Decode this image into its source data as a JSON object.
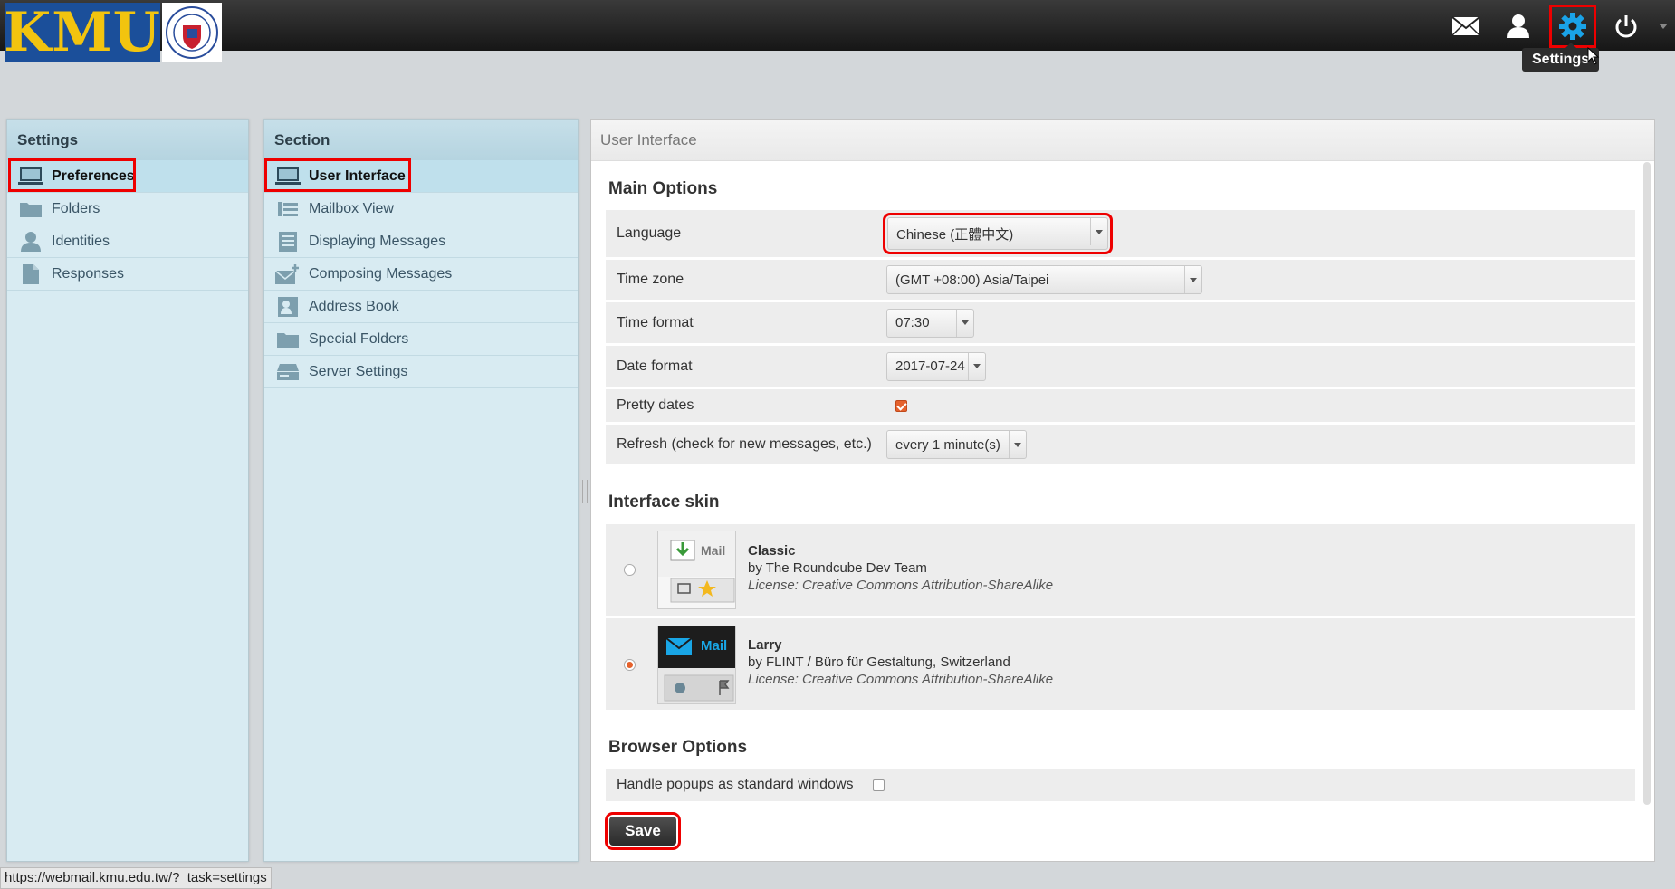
{
  "header": {
    "logo_text": "KMU",
    "tooltip": "Settings",
    "icons": [
      "mail-icon",
      "user-icon",
      "gear-icon",
      "power-icon"
    ]
  },
  "settings_panel": {
    "title": "Settings",
    "items": [
      {
        "label": "Preferences",
        "icon": "monitor-icon",
        "selected": true
      },
      {
        "label": "Folders",
        "icon": "folder-icon"
      },
      {
        "label": "Identities",
        "icon": "person-icon"
      },
      {
        "label": "Responses",
        "icon": "document-icon"
      }
    ]
  },
  "section_panel": {
    "title": "Section",
    "items": [
      {
        "label": "User Interface",
        "icon": "monitor-icon",
        "selected": true
      },
      {
        "label": "Mailbox View",
        "icon": "list-icon"
      },
      {
        "label": "Displaying Messages",
        "icon": "message-icon"
      },
      {
        "label": "Composing Messages",
        "icon": "compose-icon"
      },
      {
        "label": "Address Book",
        "icon": "addressbook-icon"
      },
      {
        "label": "Special Folders",
        "icon": "folder-icon"
      },
      {
        "label": "Server Settings",
        "icon": "server-icon"
      }
    ]
  },
  "main": {
    "title": "User Interface",
    "main_options_title": "Main Options",
    "rows": {
      "language": {
        "label": "Language",
        "value": "Chinese (正體中文)"
      },
      "timezone": {
        "label": "Time zone",
        "value": "(GMT +08:00) Asia/Taipei"
      },
      "time_format": {
        "label": "Time format",
        "value": "07:30"
      },
      "date_format": {
        "label": "Date format",
        "value": "2017-07-24"
      },
      "pretty_dates": {
        "label": "Pretty dates",
        "checked": true
      },
      "refresh": {
        "label": "Refresh (check for new messages, etc.)",
        "value": "every 1 minute(s)"
      }
    },
    "skin_title": "Interface skin",
    "skins": [
      {
        "name": "Classic",
        "author": "by The Roundcube Dev Team",
        "license": "License: Creative Commons Attribution-ShareAlike",
        "thumb_label": "Mail",
        "selected": false
      },
      {
        "name": "Larry",
        "author": "by FLINT / Büro für Gestaltung, Switzerland",
        "license": "License: Creative Commons Attribution-ShareAlike",
        "thumb_label": "Mail",
        "selected": true
      }
    ],
    "browser_title": "Browser Options",
    "popups": {
      "label": "Handle popups as standard windows",
      "checked": false
    },
    "save_label": "Save"
  },
  "status_url": "https://webmail.kmu.edu.tw/?_task=settings",
  "colors": {
    "accent": "#e5622d",
    "highlight_box": "#ee0000",
    "gear": "#1aa3e8",
    "panel_bg": "#d8ebf2"
  }
}
